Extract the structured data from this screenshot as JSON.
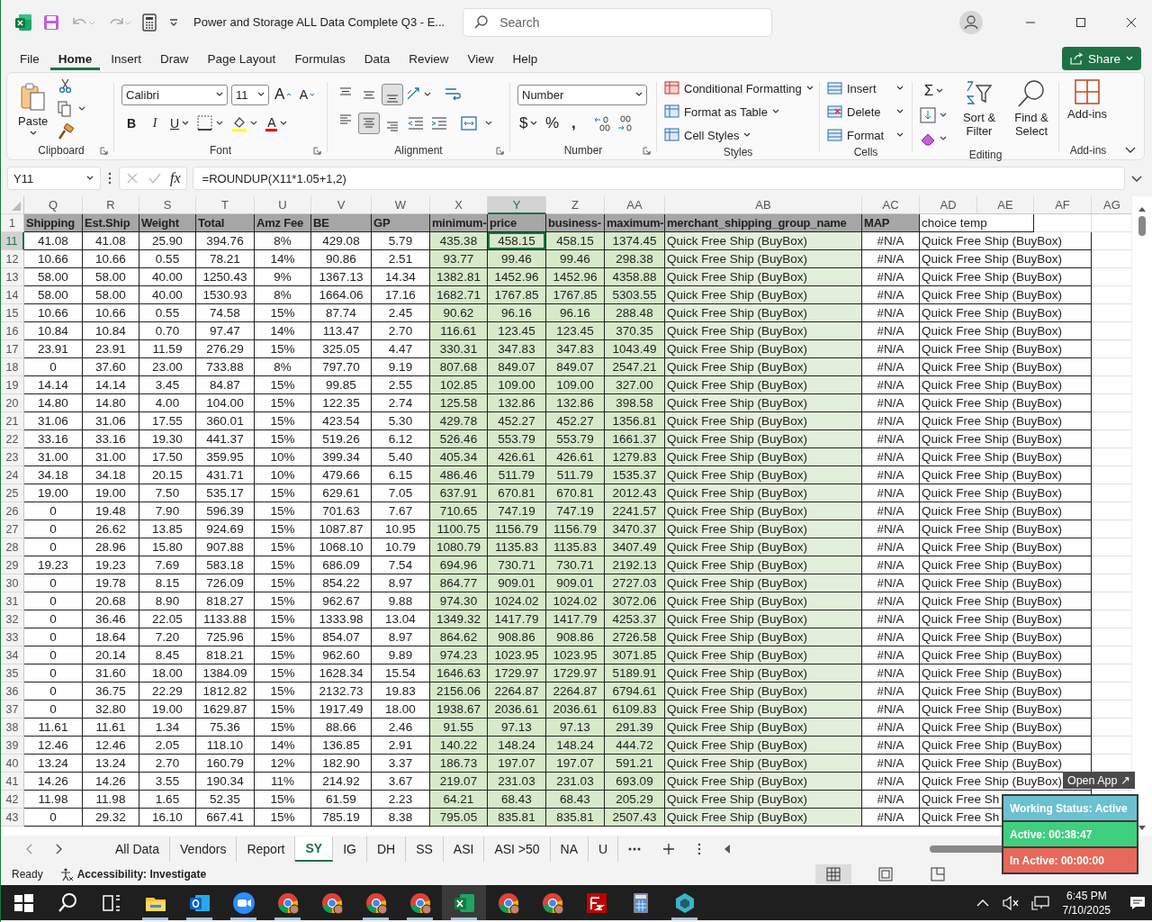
{
  "window": {
    "title": "Power and Storage ALL Data Complete Q3  -  E...",
    "search_placeholder": "Search"
  },
  "menu_tabs": [
    {
      "label": "File",
      "selected": false
    },
    {
      "label": "Home",
      "selected": true
    },
    {
      "label": "Insert",
      "selected": false
    },
    {
      "label": "Draw",
      "selected": false
    },
    {
      "label": "Page Layout",
      "selected": false
    },
    {
      "label": "Formulas",
      "selected": false
    },
    {
      "label": "Data",
      "selected": false
    },
    {
      "label": "Review",
      "selected": false
    },
    {
      "label": "View",
      "selected": false
    },
    {
      "label": "Help",
      "selected": false
    }
  ],
  "share_button": "Share",
  "ribbon": {
    "clipboard": {
      "paste": "Paste",
      "label": "Clipboard"
    },
    "font": {
      "name": "Calibri",
      "size": "11",
      "grow": "A",
      "shrink": "A",
      "bold": "B",
      "italic": "I",
      "underline": "U",
      "color_letter": "A",
      "label": "Font"
    },
    "alignment": {
      "vertical": [
        {
          "selected": false
        },
        {
          "selected": false
        },
        {
          "selected": true
        }
      ],
      "horizontal": [
        {
          "selected": false
        },
        {
          "selected": true
        },
        {
          "selected": false
        }
      ],
      "label": "Alignment"
    },
    "number": {
      "format": "Number",
      "currency": "$",
      "percent": "%",
      "comma": ",",
      "label": "Number"
    },
    "styles": {
      "items": [
        "Conditional Formatting",
        "Format as Table",
        "Cell Styles"
      ],
      "label": "Styles"
    },
    "cells": {
      "items": [
        "Insert",
        "Delete",
        "Format"
      ],
      "label": "Cells"
    },
    "editing": {
      "sum": "Σ",
      "sort": "Sort & Filter",
      "find": "Find & Select",
      "label": "Editing"
    },
    "addins": {
      "button": "Add-ins",
      "label": "Add-ins"
    }
  },
  "formula_bar": {
    "name_box": "Y11",
    "function_label": "fx",
    "formula": "=ROUNDUP(X11*1.05+1,2)"
  },
  "sheet": {
    "column_letters": [
      {
        "label": "Q",
        "selected": false
      },
      {
        "label": "R",
        "selected": false
      },
      {
        "label": "S",
        "selected": false
      },
      {
        "label": "T",
        "selected": false
      },
      {
        "label": "U",
        "selected": false
      },
      {
        "label": "V",
        "selected": false
      },
      {
        "label": "W",
        "selected": false
      },
      {
        "label": "X",
        "selected": false
      },
      {
        "label": "Y",
        "selected": true
      },
      {
        "label": "Z",
        "selected": false
      },
      {
        "label": "AA",
        "selected": false
      },
      {
        "label": "AB",
        "selected": false
      },
      {
        "label": "AC",
        "selected": false
      },
      {
        "label": "AD",
        "selected": false
      },
      {
        "label": "AE",
        "selected": false
      },
      {
        "label": "AF",
        "selected": false
      },
      {
        "label": "AG",
        "selected": false
      }
    ],
    "header_row": {
      "number": "1",
      "cells": [
        "Shipping",
        "Est.Ship",
        "Weight",
        "Total",
        "Amz Fee",
        "BE",
        "GP",
        "minimum-",
        "price",
        "business-",
        "maximum-",
        "merchant_shipping_group_name",
        "MAP",
        "choice temp"
      ]
    },
    "rows": [
      {
        "number": "11",
        "selected": true,
        "cells": [
          "41.08",
          "41.08",
          "25.90",
          "394.76",
          "8%",
          "429.08",
          "5.79",
          "435.38",
          "458.15",
          "458.15",
          "1374.45",
          "Quick Free Ship (BuyBox)",
          "#N/A",
          "Quick Free Ship (BuyBox)"
        ]
      },
      {
        "number": "12",
        "selected": false,
        "cells": [
          "10.66",
          "10.66",
          "0.55",
          "78.21",
          "14%",
          "90.86",
          "2.51",
          "93.77",
          "99.46",
          "99.46",
          "298.38",
          "Quick Free Ship (BuyBox)",
          "#N/A",
          "Quick Free Ship (BuyBox)"
        ]
      },
      {
        "number": "13",
        "selected": false,
        "cells": [
          "58.00",
          "58.00",
          "40.00",
          "1250.43",
          "9%",
          "1367.13",
          "14.34",
          "1382.81",
          "1452.96",
          "1452.96",
          "4358.88",
          "Quick Free Ship (BuyBox)",
          "#N/A",
          "Quick Free Ship (BuyBox)"
        ]
      },
      {
        "number": "14",
        "selected": false,
        "cells": [
          "58.00",
          "58.00",
          "40.00",
          "1530.93",
          "8%",
          "1664.06",
          "17.16",
          "1682.71",
          "1767.85",
          "1767.85",
          "5303.55",
          "Quick Free Ship (BuyBox)",
          "#N/A",
          "Quick Free Ship (BuyBox)"
        ]
      },
      {
        "number": "15",
        "selected": false,
        "cells": [
          "10.66",
          "10.66",
          "0.55",
          "74.58",
          "15%",
          "87.74",
          "2.45",
          "90.62",
          "96.16",
          "96.16",
          "288.48",
          "Quick Free Ship (BuyBox)",
          "#N/A",
          "Quick Free Ship (BuyBox)"
        ]
      },
      {
        "number": "16",
        "selected": false,
        "cells": [
          "10.84",
          "10.84",
          "0.70",
          "97.47",
          "14%",
          "113.47",
          "2.70",
          "116.61",
          "123.45",
          "123.45",
          "370.35",
          "Quick Free Ship (BuyBox)",
          "#N/A",
          "Quick Free Ship (BuyBox)"
        ]
      },
      {
        "number": "17",
        "selected": false,
        "cells": [
          "23.91",
          "23.91",
          "11.59",
          "276.29",
          "15%",
          "325.05",
          "4.47",
          "330.31",
          "347.83",
          "347.83",
          "1043.49",
          "Quick Free Ship (BuyBox)",
          "#N/A",
          "Quick Free Ship (BuyBox)"
        ]
      },
      {
        "number": "18",
        "selected": false,
        "cells": [
          "0",
          "37.60",
          "23.00",
          "733.88",
          "8%",
          "797.70",
          "9.19",
          "807.68",
          "849.07",
          "849.07",
          "2547.21",
          "Quick Free Ship (BuyBox)",
          "#N/A",
          "Quick Free Ship (BuyBox)"
        ]
      },
      {
        "number": "19",
        "selected": false,
        "cells": [
          "14.14",
          "14.14",
          "3.45",
          "84.87",
          "15%",
          "99.85",
          "2.55",
          "102.85",
          "109.00",
          "109.00",
          "327.00",
          "Quick Free Ship (BuyBox)",
          "#N/A",
          "Quick Free Ship (BuyBox)"
        ]
      },
      {
        "number": "20",
        "selected": false,
        "cells": [
          "14.80",
          "14.80",
          "4.00",
          "104.00",
          "15%",
          "122.35",
          "2.74",
          "125.58",
          "132.86",
          "132.86",
          "398.58",
          "Quick Free Ship (BuyBox)",
          "#N/A",
          "Quick Free Ship (BuyBox)"
        ]
      },
      {
        "number": "21",
        "selected": false,
        "cells": [
          "31.06",
          "31.06",
          "17.55",
          "360.01",
          "15%",
          "423.54",
          "5.30",
          "429.78",
          "452.27",
          "452.27",
          "1356.81",
          "Quick Free Ship (BuyBox)",
          "#N/A",
          "Quick Free Ship (BuyBox)"
        ]
      },
      {
        "number": "22",
        "selected": false,
        "cells": [
          "33.16",
          "33.16",
          "19.30",
          "441.37",
          "15%",
          "519.26",
          "6.12",
          "526.46",
          "553.79",
          "553.79",
          "1661.37",
          "Quick Free Ship (BuyBox)",
          "#N/A",
          "Quick Free Ship (BuyBox)"
        ]
      },
      {
        "number": "23",
        "selected": false,
        "cells": [
          "31.00",
          "31.00",
          "17.50",
          "359.95",
          "10%",
          "399.34",
          "5.40",
          "405.34",
          "426.61",
          "426.61",
          "1279.83",
          "Quick Free Ship (BuyBox)",
          "#N/A",
          "Quick Free Ship (BuyBox)"
        ]
      },
      {
        "number": "24",
        "selected": false,
        "cells": [
          "34.18",
          "34.18",
          "20.15",
          "431.71",
          "10%",
          "479.66",
          "6.15",
          "486.46",
          "511.79",
          "511.79",
          "1535.37",
          "Quick Free Ship (BuyBox)",
          "#N/A",
          "Quick Free Ship (BuyBox)"
        ]
      },
      {
        "number": "25",
        "selected": false,
        "cells": [
          "19.00",
          "19.00",
          "7.50",
          "535.17",
          "15%",
          "629.61",
          "7.05",
          "637.91",
          "670.81",
          "670.81",
          "2012.43",
          "Quick Free Ship (BuyBox)",
          "#N/A",
          "Quick Free Ship (BuyBox)"
        ]
      },
      {
        "number": "26",
        "selected": false,
        "cells": [
          "0",
          "19.48",
          "7.90",
          "596.39",
          "15%",
          "701.63",
          "7.67",
          "710.65",
          "747.19",
          "747.19",
          "2241.57",
          "Quick Free Ship (BuyBox)",
          "#N/A",
          "Quick Free Ship (BuyBox)"
        ]
      },
      {
        "number": "27",
        "selected": false,
        "cells": [
          "0",
          "26.62",
          "13.85",
          "924.69",
          "15%",
          "1087.87",
          "10.95",
          "1100.75",
          "1156.79",
          "1156.79",
          "3470.37",
          "Quick Free Ship (BuyBox)",
          "#N/A",
          "Quick Free Ship (BuyBox)"
        ]
      },
      {
        "number": "28",
        "selected": false,
        "cells": [
          "0",
          "28.96",
          "15.80",
          "907.88",
          "15%",
          "1068.10",
          "10.79",
          "1080.79",
          "1135.83",
          "1135.83",
          "3407.49",
          "Quick Free Ship (BuyBox)",
          "#N/A",
          "Quick Free Ship (BuyBox)"
        ]
      },
      {
        "number": "29",
        "selected": false,
        "cells": [
          "19.23",
          "19.23",
          "7.69",
          "583.18",
          "15%",
          "686.09",
          "7.54",
          "694.96",
          "730.71",
          "730.71",
          "2192.13",
          "Quick Free Ship (BuyBox)",
          "#N/A",
          "Quick Free Ship (BuyBox)"
        ]
      },
      {
        "number": "30",
        "selected": false,
        "cells": [
          "0",
          "19.78",
          "8.15",
          "726.09",
          "15%",
          "854.22",
          "8.97",
          "864.77",
          "909.01",
          "909.01",
          "2727.03",
          "Quick Free Ship (BuyBox)",
          "#N/A",
          "Quick Free Ship (BuyBox)"
        ]
      },
      {
        "number": "31",
        "selected": false,
        "cells": [
          "0",
          "20.68",
          "8.90",
          "818.27",
          "15%",
          "962.67",
          "9.88",
          "974.30",
          "1024.02",
          "1024.02",
          "3072.06",
          "Quick Free Ship (BuyBox)",
          "#N/A",
          "Quick Free Ship (BuyBox)"
        ]
      },
      {
        "number": "32",
        "selected": false,
        "cells": [
          "0",
          "36.46",
          "22.05",
          "1133.88",
          "15%",
          "1333.98",
          "13.04",
          "1349.32",
          "1417.79",
          "1417.79",
          "4253.37",
          "Quick Free Ship (BuyBox)",
          "#N/A",
          "Quick Free Ship (BuyBox)"
        ]
      },
      {
        "number": "33",
        "selected": false,
        "cells": [
          "0",
          "18.64",
          "7.20",
          "725.96",
          "15%",
          "854.07",
          "8.97",
          "864.62",
          "908.86",
          "908.86",
          "2726.58",
          "Quick Free Ship (BuyBox)",
          "#N/A",
          "Quick Free Ship (BuyBox)"
        ]
      },
      {
        "number": "34",
        "selected": false,
        "cells": [
          "0",
          "20.14",
          "8.45",
          "818.21",
          "15%",
          "962.60",
          "9.89",
          "974.23",
          "1023.95",
          "1023.95",
          "3071.85",
          "Quick Free Ship (BuyBox)",
          "#N/A",
          "Quick Free Ship (BuyBox)"
        ]
      },
      {
        "number": "35",
        "selected": false,
        "cells": [
          "0",
          "31.60",
          "18.00",
          "1384.09",
          "15%",
          "1628.34",
          "15.54",
          "1646.63",
          "1729.97",
          "1729.97",
          "5189.91",
          "Quick Free Ship (BuyBox)",
          "#N/A",
          "Quick Free Ship (BuyBox)"
        ]
      },
      {
        "number": "36",
        "selected": false,
        "cells": [
          "0",
          "36.75",
          "22.29",
          "1812.82",
          "15%",
          "2132.73",
          "19.83",
          "2156.06",
          "2264.87",
          "2264.87",
          "6794.61",
          "Quick Free Ship (BuyBox)",
          "#N/A",
          "Quick Free Ship (BuyBox)"
        ]
      },
      {
        "number": "37",
        "selected": false,
        "cells": [
          "0",
          "32.80",
          "19.00",
          "1629.87",
          "15%",
          "1917.49",
          "18.00",
          "1938.67",
          "2036.61",
          "2036.61",
          "6109.83",
          "Quick Free Ship (BuyBox)",
          "#N/A",
          "Quick Free Ship (BuyBox)"
        ]
      },
      {
        "number": "38",
        "selected": false,
        "cells": [
          "11.61",
          "11.61",
          "1.34",
          "75.36",
          "15%",
          "88.66",
          "2.46",
          "91.55",
          "97.13",
          "97.13",
          "291.39",
          "Quick Free Ship (BuyBox)",
          "#N/A",
          "Quick Free Ship (BuyBox)"
        ]
      },
      {
        "number": "39",
        "selected": false,
        "cells": [
          "12.46",
          "12.46",
          "2.05",
          "118.10",
          "14%",
          "136.85",
          "2.91",
          "140.22",
          "148.24",
          "148.24",
          "444.72",
          "Quick Free Ship (BuyBox)",
          "#N/A",
          "Quick Free Ship (BuyBox)"
        ]
      },
      {
        "number": "40",
        "selected": false,
        "cells": [
          "13.24",
          "13.24",
          "2.70",
          "160.79",
          "12%",
          "182.90",
          "3.37",
          "186.73",
          "197.07",
          "197.07",
          "591.21",
          "Quick Free Ship (BuyBox)",
          "#N/A",
          "Quick Free Ship (BuyBox)"
        ]
      },
      {
        "number": "41",
        "selected": false,
        "cells": [
          "14.26",
          "14.26",
          "3.55",
          "190.34",
          "11%",
          "214.92",
          "3.67",
          "219.07",
          "231.03",
          "231.03",
          "693.09",
          "Quick Free Ship (BuyBox)",
          "#N/A",
          "Quick Free Ship (BuyBox)"
        ]
      },
      {
        "number": "42",
        "selected": false,
        "cells": [
          "11.98",
          "11.98",
          "1.65",
          "52.35",
          "15%",
          "61.59",
          "2.23",
          "64.21",
          "68.43",
          "68.43",
          "205.29",
          "Quick Free Ship (BuyBox)",
          "#N/A",
          "Quick Free Sh"
        ]
      },
      {
        "number": "43",
        "selected": false,
        "cells": [
          "0",
          "29.32",
          "16.10",
          "667.41",
          "15%",
          "785.19",
          "8.38",
          "795.05",
          "835.81",
          "835.81",
          "2507.43",
          "Quick Free Ship (BuyBox)",
          "#N/A",
          "Quick Free Sh"
        ]
      }
    ]
  },
  "sheet_tabs": [
    {
      "label": "All Data",
      "selected": false
    },
    {
      "label": "Vendors",
      "selected": false
    },
    {
      "label": "Report",
      "selected": false
    },
    {
      "label": "SY",
      "selected": true
    },
    {
      "label": "IG",
      "selected": false
    },
    {
      "label": "DH",
      "selected": false
    },
    {
      "label": "SS",
      "selected": false
    },
    {
      "label": "ASI",
      "selected": false
    },
    {
      "label": "ASI >50",
      "selected": false
    },
    {
      "label": "NA",
      "selected": false
    },
    {
      "label": "U",
      "selected": false
    }
  ],
  "status_bar": {
    "mode": "Ready",
    "accessibility": "Accessibility: Investigate"
  },
  "tracker_widget": {
    "open_button": "Open App ↗",
    "statuses": [
      {
        "label": "Working Status: Active",
        "color": "#6cc1d1"
      },
      {
        "label": "Active: 00:38:47",
        "color": "#3fcf7f"
      },
      {
        "label": "In Active: 00:00:00",
        "color": "#e8685b"
      }
    ]
  },
  "taskbar": {
    "apps": [
      {
        "kind": "start",
        "running": false,
        "active": false
      },
      {
        "kind": "search",
        "running": false,
        "active": false
      },
      {
        "kind": "taskview",
        "running": false,
        "active": false
      },
      {
        "kind": "explorer",
        "running": true,
        "active": false
      },
      {
        "kind": "outlook",
        "running": true,
        "active": false
      },
      {
        "kind": "zoom",
        "running": true,
        "active": false
      },
      {
        "kind": "chrome",
        "running": true,
        "active": false
      },
      {
        "kind": "chrome",
        "running": false,
        "active": false
      },
      {
        "kind": "chrome",
        "running": true,
        "active": false
      },
      {
        "kind": "chrome",
        "running": true,
        "active": false
      },
      {
        "kind": "excel",
        "running": true,
        "active": true
      },
      {
        "kind": "chrome",
        "running": false,
        "active": false
      },
      {
        "kind": "chrome",
        "running": false,
        "active": false
      },
      {
        "kind": "filezilla",
        "running": false,
        "active": false
      },
      {
        "kind": "calculator",
        "running": false,
        "active": false
      },
      {
        "kind": "cube",
        "running": true,
        "active": false
      }
    ],
    "time": "6:45 PM",
    "date": "7/10/2025"
  }
}
